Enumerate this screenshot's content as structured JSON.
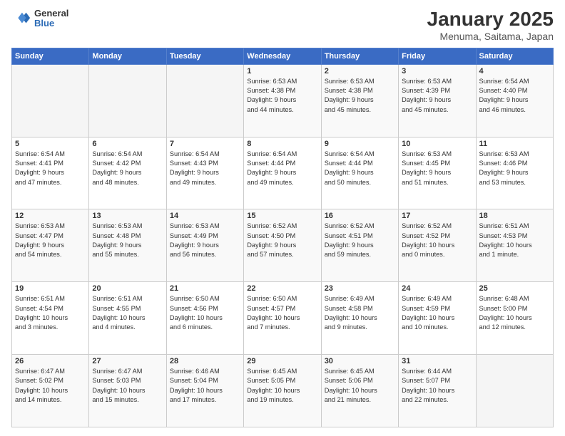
{
  "logo": {
    "general": "General",
    "blue": "Blue"
  },
  "title": "January 2025",
  "subtitle": "Menuma, Saitama, Japan",
  "weekdays": [
    "Sunday",
    "Monday",
    "Tuesday",
    "Wednesday",
    "Thursday",
    "Friday",
    "Saturday"
  ],
  "weeks": [
    [
      {
        "day": "",
        "info": ""
      },
      {
        "day": "",
        "info": ""
      },
      {
        "day": "",
        "info": ""
      },
      {
        "day": "1",
        "info": "Sunrise: 6:53 AM\nSunset: 4:38 PM\nDaylight: 9 hours\nand 44 minutes."
      },
      {
        "day": "2",
        "info": "Sunrise: 6:53 AM\nSunset: 4:38 PM\nDaylight: 9 hours\nand 45 minutes."
      },
      {
        "day": "3",
        "info": "Sunrise: 6:53 AM\nSunset: 4:39 PM\nDaylight: 9 hours\nand 45 minutes."
      },
      {
        "day": "4",
        "info": "Sunrise: 6:54 AM\nSunset: 4:40 PM\nDaylight: 9 hours\nand 46 minutes."
      }
    ],
    [
      {
        "day": "5",
        "info": "Sunrise: 6:54 AM\nSunset: 4:41 PM\nDaylight: 9 hours\nand 47 minutes."
      },
      {
        "day": "6",
        "info": "Sunrise: 6:54 AM\nSunset: 4:42 PM\nDaylight: 9 hours\nand 48 minutes."
      },
      {
        "day": "7",
        "info": "Sunrise: 6:54 AM\nSunset: 4:43 PM\nDaylight: 9 hours\nand 49 minutes."
      },
      {
        "day": "8",
        "info": "Sunrise: 6:54 AM\nSunset: 4:44 PM\nDaylight: 9 hours\nand 49 minutes."
      },
      {
        "day": "9",
        "info": "Sunrise: 6:54 AM\nSunset: 4:44 PM\nDaylight: 9 hours\nand 50 minutes."
      },
      {
        "day": "10",
        "info": "Sunrise: 6:53 AM\nSunset: 4:45 PM\nDaylight: 9 hours\nand 51 minutes."
      },
      {
        "day": "11",
        "info": "Sunrise: 6:53 AM\nSunset: 4:46 PM\nDaylight: 9 hours\nand 53 minutes."
      }
    ],
    [
      {
        "day": "12",
        "info": "Sunrise: 6:53 AM\nSunset: 4:47 PM\nDaylight: 9 hours\nand 54 minutes."
      },
      {
        "day": "13",
        "info": "Sunrise: 6:53 AM\nSunset: 4:48 PM\nDaylight: 9 hours\nand 55 minutes."
      },
      {
        "day": "14",
        "info": "Sunrise: 6:53 AM\nSunset: 4:49 PM\nDaylight: 9 hours\nand 56 minutes."
      },
      {
        "day": "15",
        "info": "Sunrise: 6:52 AM\nSunset: 4:50 PM\nDaylight: 9 hours\nand 57 minutes."
      },
      {
        "day": "16",
        "info": "Sunrise: 6:52 AM\nSunset: 4:51 PM\nDaylight: 9 hours\nand 59 minutes."
      },
      {
        "day": "17",
        "info": "Sunrise: 6:52 AM\nSunset: 4:52 PM\nDaylight: 10 hours\nand 0 minutes."
      },
      {
        "day": "18",
        "info": "Sunrise: 6:51 AM\nSunset: 4:53 PM\nDaylight: 10 hours\nand 1 minute."
      }
    ],
    [
      {
        "day": "19",
        "info": "Sunrise: 6:51 AM\nSunset: 4:54 PM\nDaylight: 10 hours\nand 3 minutes."
      },
      {
        "day": "20",
        "info": "Sunrise: 6:51 AM\nSunset: 4:55 PM\nDaylight: 10 hours\nand 4 minutes."
      },
      {
        "day": "21",
        "info": "Sunrise: 6:50 AM\nSunset: 4:56 PM\nDaylight: 10 hours\nand 6 minutes."
      },
      {
        "day": "22",
        "info": "Sunrise: 6:50 AM\nSunset: 4:57 PM\nDaylight: 10 hours\nand 7 minutes."
      },
      {
        "day": "23",
        "info": "Sunrise: 6:49 AM\nSunset: 4:58 PM\nDaylight: 10 hours\nand 9 minutes."
      },
      {
        "day": "24",
        "info": "Sunrise: 6:49 AM\nSunset: 4:59 PM\nDaylight: 10 hours\nand 10 minutes."
      },
      {
        "day": "25",
        "info": "Sunrise: 6:48 AM\nSunset: 5:00 PM\nDaylight: 10 hours\nand 12 minutes."
      }
    ],
    [
      {
        "day": "26",
        "info": "Sunrise: 6:47 AM\nSunset: 5:02 PM\nDaylight: 10 hours\nand 14 minutes."
      },
      {
        "day": "27",
        "info": "Sunrise: 6:47 AM\nSunset: 5:03 PM\nDaylight: 10 hours\nand 15 minutes."
      },
      {
        "day": "28",
        "info": "Sunrise: 6:46 AM\nSunset: 5:04 PM\nDaylight: 10 hours\nand 17 minutes."
      },
      {
        "day": "29",
        "info": "Sunrise: 6:45 AM\nSunset: 5:05 PM\nDaylight: 10 hours\nand 19 minutes."
      },
      {
        "day": "30",
        "info": "Sunrise: 6:45 AM\nSunset: 5:06 PM\nDaylight: 10 hours\nand 21 minutes."
      },
      {
        "day": "31",
        "info": "Sunrise: 6:44 AM\nSunset: 5:07 PM\nDaylight: 10 hours\nand 22 minutes."
      },
      {
        "day": "",
        "info": ""
      }
    ]
  ]
}
